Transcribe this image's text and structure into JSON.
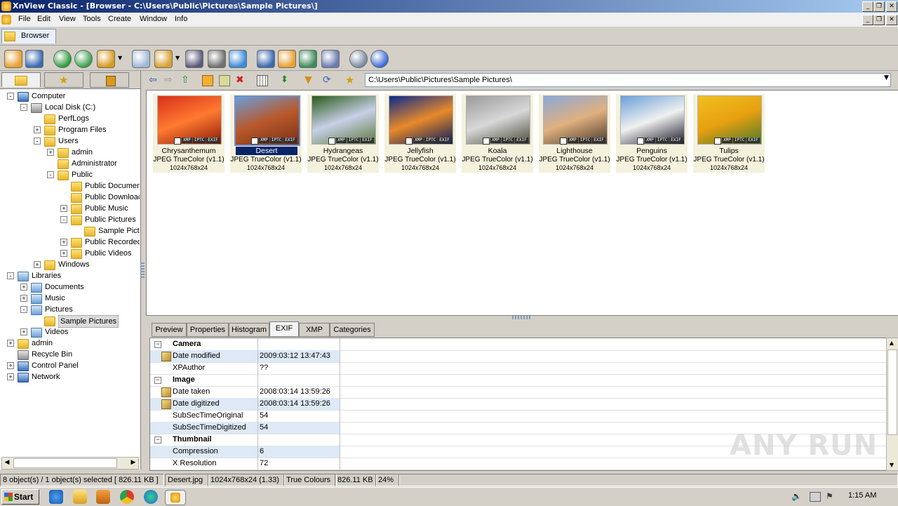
{
  "window": {
    "title": "XnView Classic - [Browser - C:\\Users\\Public\\Pictures\\Sample Pictures\\]"
  },
  "menu": [
    "File",
    "Edit",
    "View",
    "Tools",
    "Create",
    "Window",
    "Info"
  ],
  "tab": {
    "label": "Browser"
  },
  "toolbar_icons": [
    "open-icon",
    "fullscreen-icon",
    "refresh-icon",
    "rotate-icon",
    "move-icon",
    "dropdown-icon",
    "new-icon",
    "copy-icon",
    "dropdown-icon",
    "find-icon",
    "print-icon",
    "slideshow-icon",
    "capture-icon",
    "screen-icon",
    "web-icon",
    "grid-icon",
    "settings-icon",
    "info-icon"
  ],
  "tree": [
    {
      "label": "Computer",
      "icon": "computer-icon",
      "level": 0,
      "exp": "-"
    },
    {
      "label": "Local Disk (C:)",
      "icon": "disk-icon",
      "level": 1,
      "exp": "-"
    },
    {
      "label": "PerfLogs",
      "icon": "folder-icon",
      "level": 2,
      "exp": ""
    },
    {
      "label": "Program Files",
      "icon": "folder-icon",
      "level": 2,
      "exp": "+"
    },
    {
      "label": "Users",
      "icon": "folder-icon",
      "level": 2,
      "exp": "-"
    },
    {
      "label": "admin",
      "icon": "folder-icon",
      "level": 3,
      "exp": "+"
    },
    {
      "label": "Administrator",
      "icon": "folder-icon",
      "level": 3,
      "exp": ""
    },
    {
      "label": "Public",
      "icon": "folder-icon",
      "level": 3,
      "exp": "-"
    },
    {
      "label": "Public Documen",
      "icon": "folder-icon",
      "level": 4,
      "exp": ""
    },
    {
      "label": "Public Downloac",
      "icon": "folder-icon",
      "level": 4,
      "exp": ""
    },
    {
      "label": "Public Music",
      "icon": "folder-icon",
      "level": 4,
      "exp": "+"
    },
    {
      "label": "Public Pictures",
      "icon": "folder-icon",
      "level": 4,
      "exp": "-"
    },
    {
      "label": "Sample Pictu",
      "icon": "folder-icon",
      "level": 5,
      "exp": ""
    },
    {
      "label": "Public Recorded",
      "icon": "folder-icon",
      "level": 4,
      "exp": "+"
    },
    {
      "label": "Public Videos",
      "icon": "folder-icon",
      "level": 4,
      "exp": "+"
    },
    {
      "label": "Windows",
      "icon": "folder-icon",
      "level": 2,
      "exp": "+"
    },
    {
      "label": "Libraries",
      "icon": "library-icon",
      "level": 0,
      "exp": "-"
    },
    {
      "label": "Documents",
      "icon": "library-icon",
      "level": 1,
      "exp": "+"
    },
    {
      "label": "Music",
      "icon": "library-icon",
      "level": 1,
      "exp": "+"
    },
    {
      "label": "Pictures",
      "icon": "library-icon",
      "level": 1,
      "exp": "-"
    },
    {
      "label": "Sample Pictures",
      "icon": "folder-icon",
      "level": 2,
      "exp": "",
      "selected": true
    },
    {
      "label": "Videos",
      "icon": "library-icon",
      "level": 1,
      "exp": "+"
    },
    {
      "label": "admin",
      "icon": "folder-icon",
      "level": 0,
      "exp": "+"
    },
    {
      "label": "Recycle Bin",
      "icon": "recycle-icon",
      "level": 0,
      "exp": ""
    },
    {
      "label": "Control Panel",
      "icon": "control-panel-icon",
      "level": 0,
      "exp": "+"
    },
    {
      "label": "Network",
      "icon": "network-icon",
      "level": 0,
      "exp": "+"
    }
  ],
  "path": "C:\\Users\\Public\\Pictures\\Sample Pictures\\",
  "thumbnails": [
    {
      "name": "Chrysanthemum",
      "format": "JPEG TrueColor (v1.1)",
      "dims": "1024x768x24",
      "colors": [
        "#d8301a",
        "#ff7a30",
        "#8a1a08"
      ]
    },
    {
      "name": "Desert",
      "format": "JPEG TrueColor (v1.1)",
      "dims": "1024x768x24",
      "colors": [
        "#6a9ed8",
        "#b8582a",
        "#7a3018"
      ],
      "selected": true
    },
    {
      "name": "Hydrangeas",
      "format": "JPEG TrueColor (v1.1)",
      "dims": "1024x768x24",
      "colors": [
        "#2a5a1a",
        "#c8d0e8",
        "#5a7a3a"
      ]
    },
    {
      "name": "Jellyfish",
      "format": "JPEG TrueColor (v1.1)",
      "dims": "1024x768x24",
      "colors": [
        "#0a2a8a",
        "#e88a2a",
        "#061a5a"
      ]
    },
    {
      "name": "Koala",
      "format": "JPEG TrueColor (v1.1)",
      "dims": "1024x768x24",
      "colors": [
        "#9a9a9a",
        "#d8d8d8",
        "#4a4a3a"
      ]
    },
    {
      "name": "Lighthouse",
      "format": "JPEG TrueColor (v1.1)",
      "dims": "1024x768x24",
      "colors": [
        "#8aa8d8",
        "#e0b080",
        "#4a3a2a"
      ]
    },
    {
      "name": "Penguins",
      "format": "JPEG TrueColor (v1.1)",
      "dims": "1024x768x24",
      "colors": [
        "#6aa0d8",
        "#f0f0f0",
        "#1a1a2a"
      ]
    },
    {
      "name": "Tulips",
      "format": "JPEG TrueColor (v1.1)",
      "dims": "1024x768x24",
      "colors": [
        "#f0c020",
        "#e8a010",
        "#4a7a2a"
      ]
    }
  ],
  "badges": [
    "XMP",
    "IPTC",
    "EXIF"
  ],
  "bottom_tabs": [
    "Preview",
    "Properties",
    "Histogram",
    "EXIF",
    "XMP",
    "Categories"
  ],
  "active_bottom_tab": "EXIF",
  "exif": [
    {
      "type": "group",
      "label": "Camera"
    },
    {
      "type": "row",
      "key": "Date modified",
      "value": "2009:03:12 13:47:43",
      "edit": true,
      "hl": true
    },
    {
      "type": "row",
      "key": "XPAuthor",
      "value": "??"
    },
    {
      "type": "group",
      "label": "Image"
    },
    {
      "type": "row",
      "key": "Date taken",
      "value": "2008:03:14 13:59:26",
      "edit": true
    },
    {
      "type": "row",
      "key": "Date digitized",
      "value": "2008:03:14 13:59:26",
      "edit": true,
      "hl": true
    },
    {
      "type": "row",
      "key": "SubSecTimeOriginal",
      "value": "54"
    },
    {
      "type": "row",
      "key": "SubSecTimeDigitized",
      "value": "54",
      "hl": true
    },
    {
      "type": "group",
      "label": "Thumbnail"
    },
    {
      "type": "row",
      "key": "Compression",
      "value": "6",
      "hl": true
    },
    {
      "type": "row",
      "key": "X Resolution",
      "value": "72"
    }
  ],
  "status": {
    "selection": "8 object(s) / 1 object(s) selected  [ 826.11 KB ]",
    "filename": "Desert.jpg",
    "dimensions": "1024x768x24 (1.33)",
    "colors": "True Colours",
    "size": "826.11 KB",
    "zoom": "24%"
  },
  "taskbar": {
    "start": "Start",
    "clock": "1:15 AM"
  },
  "watermark": "ANY RUN"
}
